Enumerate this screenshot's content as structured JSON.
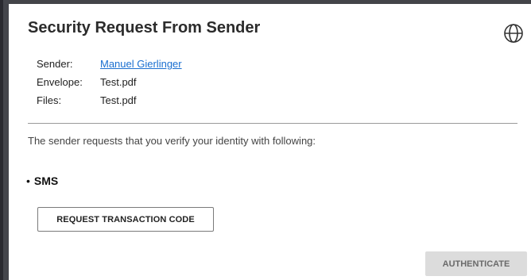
{
  "dialog": {
    "title": "Security Request From Sender",
    "language_icon": "globe-icon"
  },
  "meta": {
    "sender_label": "Sender:",
    "sender_value": "Manuel Gierlinger",
    "envelope_label": "Envelope:",
    "envelope_value": "Test.pdf",
    "files_label": "Files:",
    "files_value": "Test.pdf"
  },
  "instruction": "The sender requests that you verify your identity with following:",
  "method": {
    "bullet": "•",
    "name": "SMS"
  },
  "buttons": {
    "request_code": "REQUEST TRANSACTION CODE",
    "authenticate": "AUTHENTICATE"
  },
  "colors": {
    "link": "#1a6fd0",
    "disabled_button_bg": "#dcdcdc",
    "backdrop": "#3d3e42"
  }
}
